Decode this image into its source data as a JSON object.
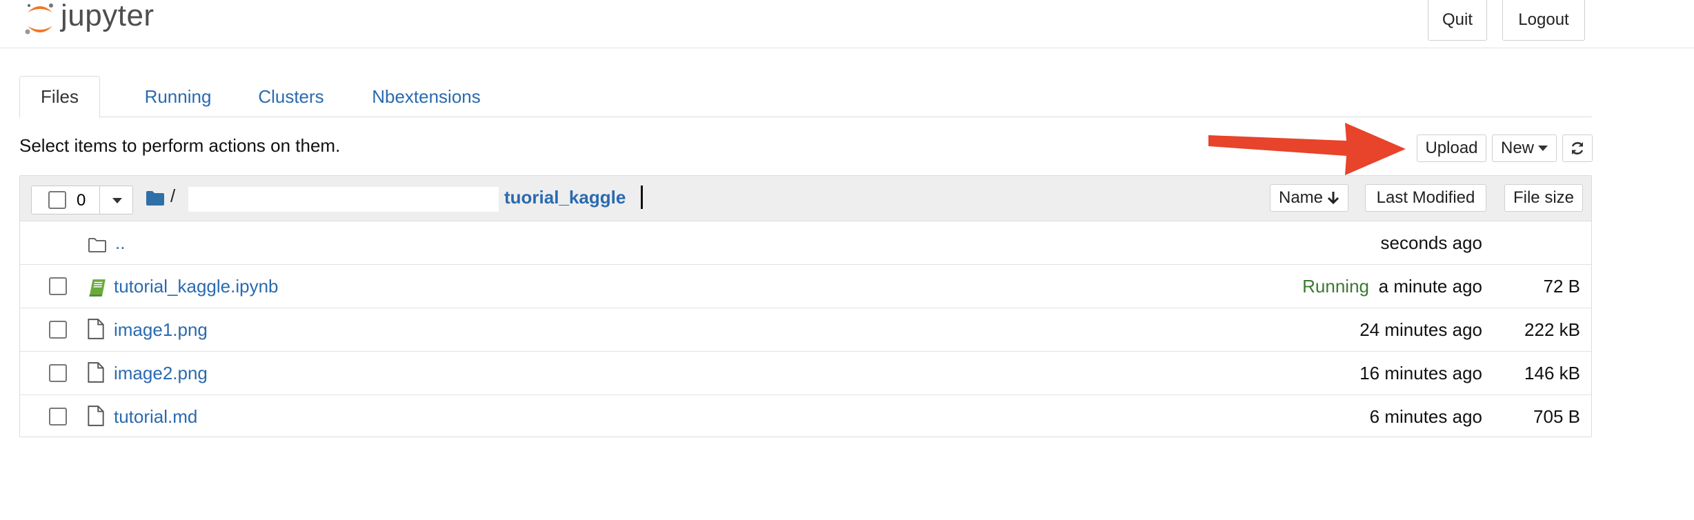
{
  "header": {
    "logo_text": "jupyter",
    "quit_label": "Quit",
    "logout_label": "Logout",
    "brand_color": "#f37726"
  },
  "tabs": [
    {
      "label": "Files",
      "active": true
    },
    {
      "label": "Running",
      "active": false
    },
    {
      "label": "Clusters",
      "active": false
    },
    {
      "label": "Nbextensions",
      "active": false
    }
  ],
  "hint_text": "Select items to perform actions on them.",
  "toolbar": {
    "upload_label": "Upload",
    "new_label": "New",
    "refresh_icon": "refresh-icon"
  },
  "list_header": {
    "selected_count": "0",
    "breadcrumb_root": "/",
    "breadcrumb_dir": "tuorial_kaggle",
    "sort_name_label": "Name",
    "sort_modified_label": "Last Modified",
    "sort_size_label": "File size"
  },
  "rows": [
    {
      "name": "..",
      "icon": "folder-icon",
      "status": "",
      "modified": "seconds ago",
      "size": ""
    },
    {
      "name": "tutorial_kaggle.ipynb",
      "icon": "notebook-icon",
      "status": "Running",
      "modified": "a minute ago",
      "size": "72 B"
    },
    {
      "name": "image1.png",
      "icon": "file-icon",
      "status": "",
      "modified": "24 minutes ago",
      "size": "222 kB"
    },
    {
      "name": "image2.png",
      "icon": "file-icon",
      "status": "",
      "modified": "16 minutes ago",
      "size": "146 kB"
    },
    {
      "name": "tutorial.md",
      "icon": "file-icon",
      "status": "",
      "modified": "6 minutes ago",
      "size": "705 B"
    }
  ],
  "colors": {
    "link": "#2a6ab0",
    "running": "#3a7a30",
    "annotation_arrow": "#e8432b",
    "notebook_icon": "#6aaa3c"
  }
}
